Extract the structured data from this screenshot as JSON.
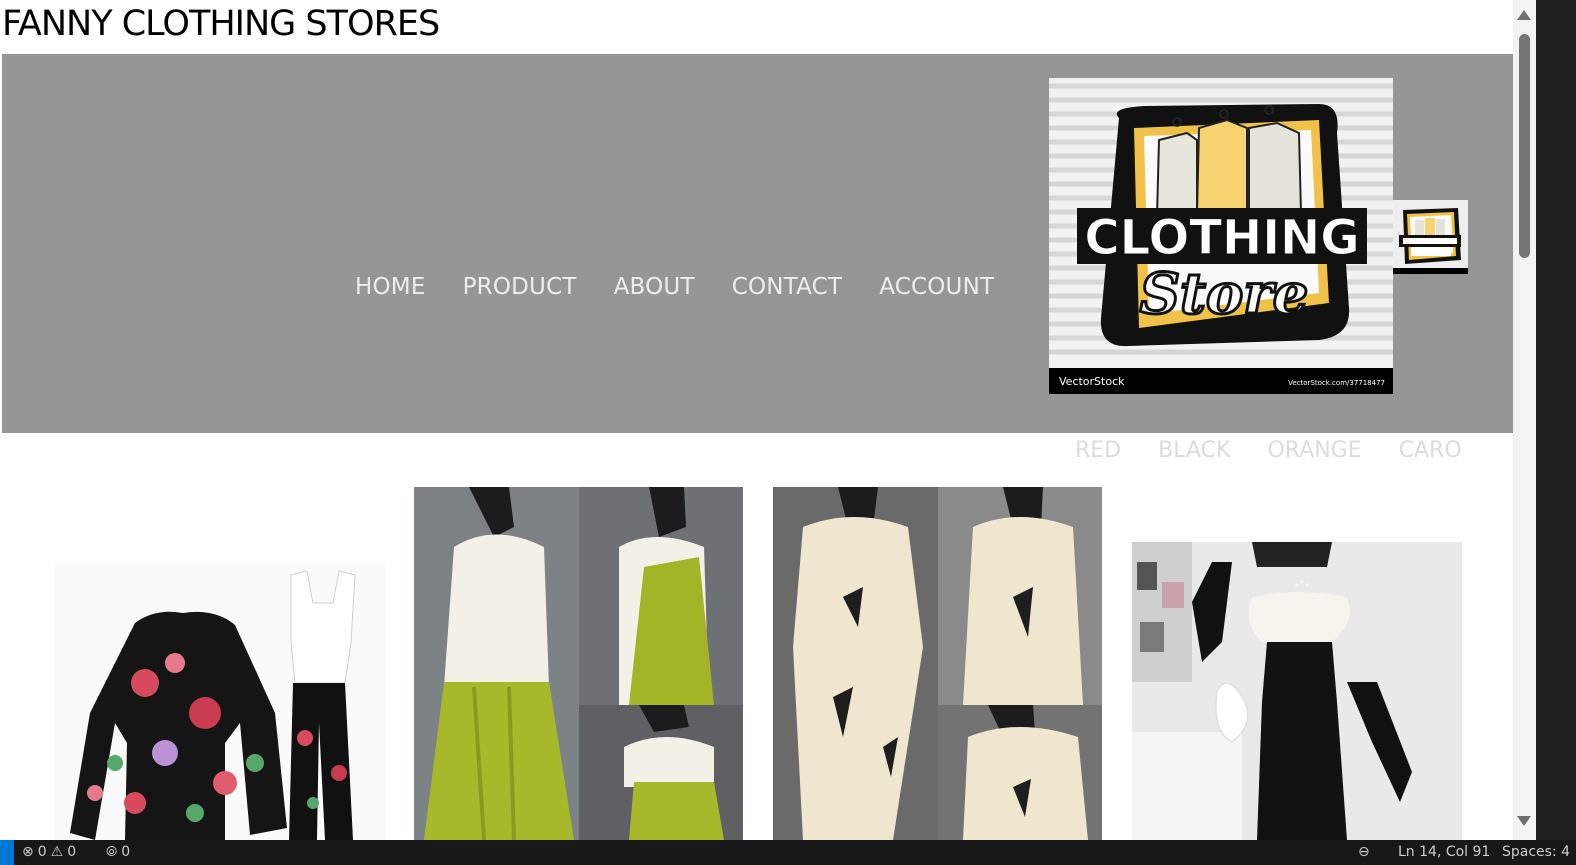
{
  "site": {
    "title": "FANNY CLOTHING STORES"
  },
  "nav": {
    "items": [
      {
        "label": "HOME"
      },
      {
        "label": "PRODUCT"
      },
      {
        "label": "ABOUT"
      },
      {
        "label": "CONTACT"
      },
      {
        "label": "ACCOUNT"
      }
    ]
  },
  "logo": {
    "line1": "CLOTHING",
    "line2": "Store",
    "watermark_left": "VectorStock",
    "watermark_right": "VectorStock.com/37718477"
  },
  "color_filters": [
    {
      "label": "RED"
    },
    {
      "label": "BLACK"
    },
    {
      "label": "ORANGE"
    },
    {
      "label": "CARO"
    }
  ],
  "statusbar": {
    "errors": "0",
    "warnings": "0",
    "ports": "0",
    "cursor": "Ln 14, Col 91",
    "spaces": "Spaces: 4"
  },
  "colors": {
    "hero_bg": "#969696",
    "nav_text": "#ededed",
    "filter_text": "#dcdcdc",
    "statusbar_bg": "#181818",
    "accent_blue": "#0078d4"
  }
}
